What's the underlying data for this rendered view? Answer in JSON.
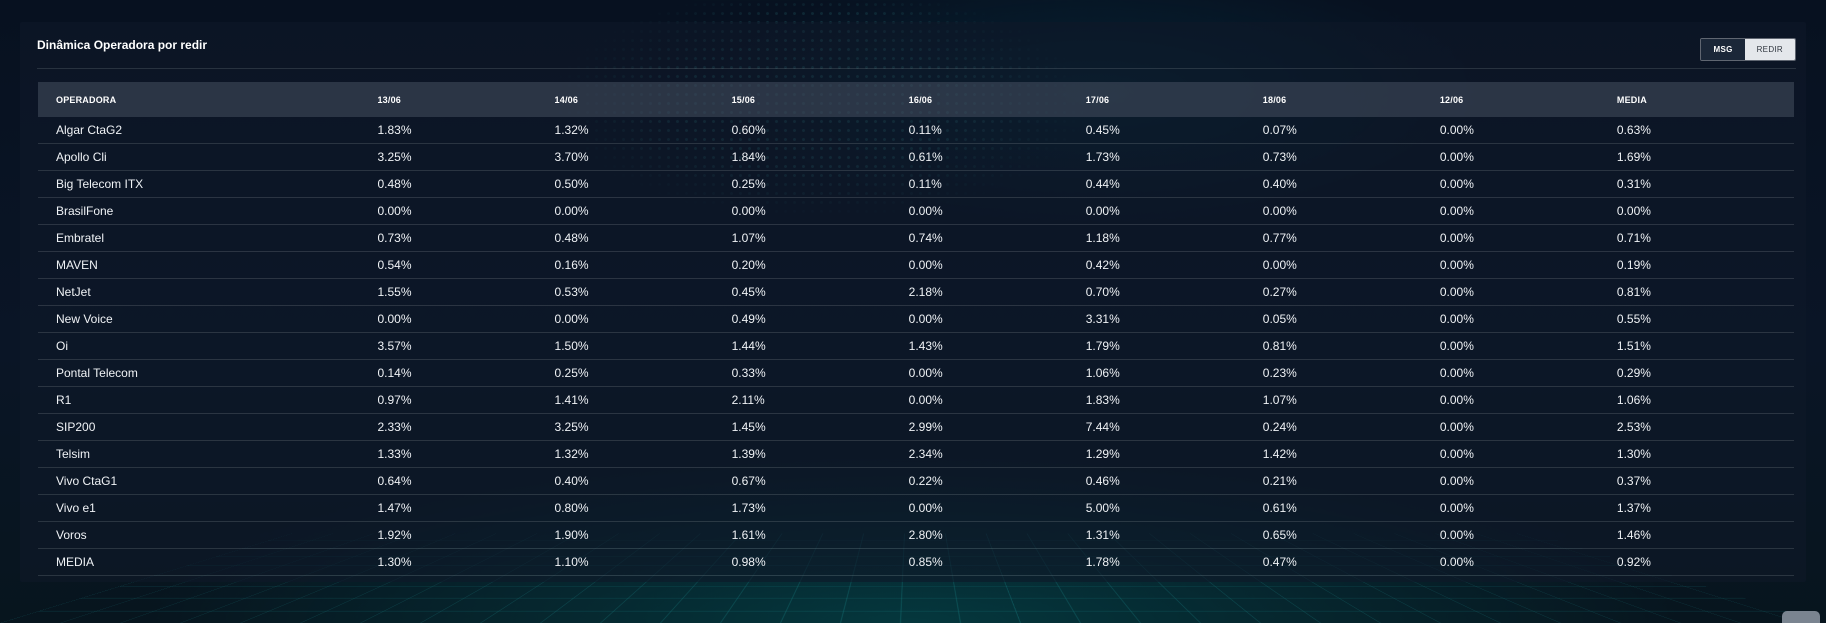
{
  "panel": {
    "title": "Dinâmica Operadora por redir",
    "toggle": {
      "msg_label": "MSG",
      "redir_label": "REDIR"
    }
  },
  "table": {
    "headers": [
      "OPERADORA",
      "13/06",
      "14/06",
      "15/06",
      "16/06",
      "17/06",
      "18/06",
      "12/06",
      "MEDIA"
    ],
    "rows": [
      [
        "Algar CtaG2",
        "1.83%",
        "1.32%",
        "0.60%",
        "0.11%",
        "0.45%",
        "0.07%",
        "0.00%",
        "0.63%"
      ],
      [
        "Apollo Cli",
        "3.25%",
        "3.70%",
        "1.84%",
        "0.61%",
        "1.73%",
        "0.73%",
        "0.00%",
        "1.69%"
      ],
      [
        "Big Telecom ITX",
        "0.48%",
        "0.50%",
        "0.25%",
        "0.11%",
        "0.44%",
        "0.40%",
        "0.00%",
        "0.31%"
      ],
      [
        "BrasilFone",
        "0.00%",
        "0.00%",
        "0.00%",
        "0.00%",
        "0.00%",
        "0.00%",
        "0.00%",
        "0.00%"
      ],
      [
        "Embratel",
        "0.73%",
        "0.48%",
        "1.07%",
        "0.74%",
        "1.18%",
        "0.77%",
        "0.00%",
        "0.71%"
      ],
      [
        "MAVEN",
        "0.54%",
        "0.16%",
        "0.20%",
        "0.00%",
        "0.42%",
        "0.00%",
        "0.00%",
        "0.19%"
      ],
      [
        "NetJet",
        "1.55%",
        "0.53%",
        "0.45%",
        "2.18%",
        "0.70%",
        "0.27%",
        "0.00%",
        "0.81%"
      ],
      [
        "New Voice",
        "0.00%",
        "0.00%",
        "0.49%",
        "0.00%",
        "3.31%",
        "0.05%",
        "0.00%",
        "0.55%"
      ],
      [
        "Oi",
        "3.57%",
        "1.50%",
        "1.44%",
        "1.43%",
        "1.79%",
        "0.81%",
        "0.00%",
        "1.51%"
      ],
      [
        "Pontal Telecom",
        "0.14%",
        "0.25%",
        "0.33%",
        "0.00%",
        "1.06%",
        "0.23%",
        "0.00%",
        "0.29%"
      ],
      [
        "R1",
        "0.97%",
        "1.41%",
        "2.11%",
        "0.00%",
        "1.83%",
        "1.07%",
        "0.00%",
        "1.06%"
      ],
      [
        "SIP200",
        "2.33%",
        "3.25%",
        "1.45%",
        "2.99%",
        "7.44%",
        "0.24%",
        "0.00%",
        "2.53%"
      ],
      [
        "Telsim",
        "1.33%",
        "1.32%",
        "1.39%",
        "2.34%",
        "1.29%",
        "1.42%",
        "0.00%",
        "1.30%"
      ],
      [
        "Vivo CtaG1",
        "0.64%",
        "0.40%",
        "0.67%",
        "0.22%",
        "0.46%",
        "0.21%",
        "0.00%",
        "0.37%"
      ],
      [
        "Vivo e1",
        "1.47%",
        "0.80%",
        "1.73%",
        "0.00%",
        "5.00%",
        "0.61%",
        "0.00%",
        "1.37%"
      ],
      [
        "Voros",
        "1.92%",
        "1.90%",
        "1.61%",
        "2.80%",
        "1.31%",
        "0.65%",
        "0.00%",
        "1.46%"
      ],
      [
        "MEDIA",
        "1.30%",
        "1.10%",
        "0.98%",
        "0.85%",
        "1.78%",
        "0.47%",
        "0.00%",
        "0.92%"
      ]
    ]
  }
}
